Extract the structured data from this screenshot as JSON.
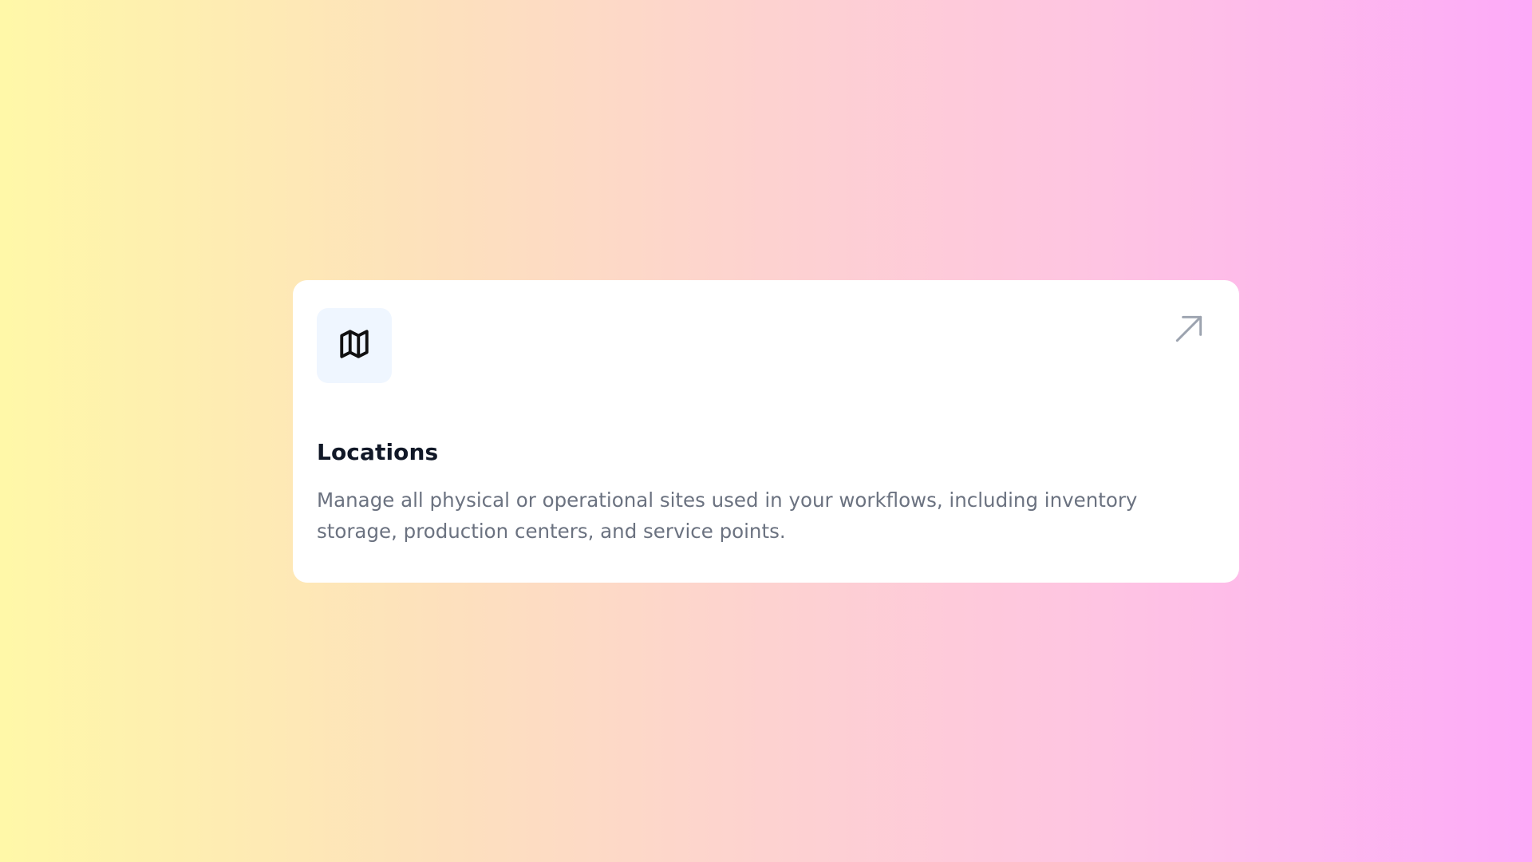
{
  "card": {
    "title": "Locations",
    "description": "Manage all physical or operational sites used in your workflows, including inventory storage, production centers, and service points.",
    "icon": "map-icon",
    "link_icon": "arrow-up-right-icon",
    "colors": {
      "icon_tile_bg": "#eff6ff",
      "title": "#111827",
      "description": "#6b7280",
      "arrow": "#9ca3af"
    }
  }
}
